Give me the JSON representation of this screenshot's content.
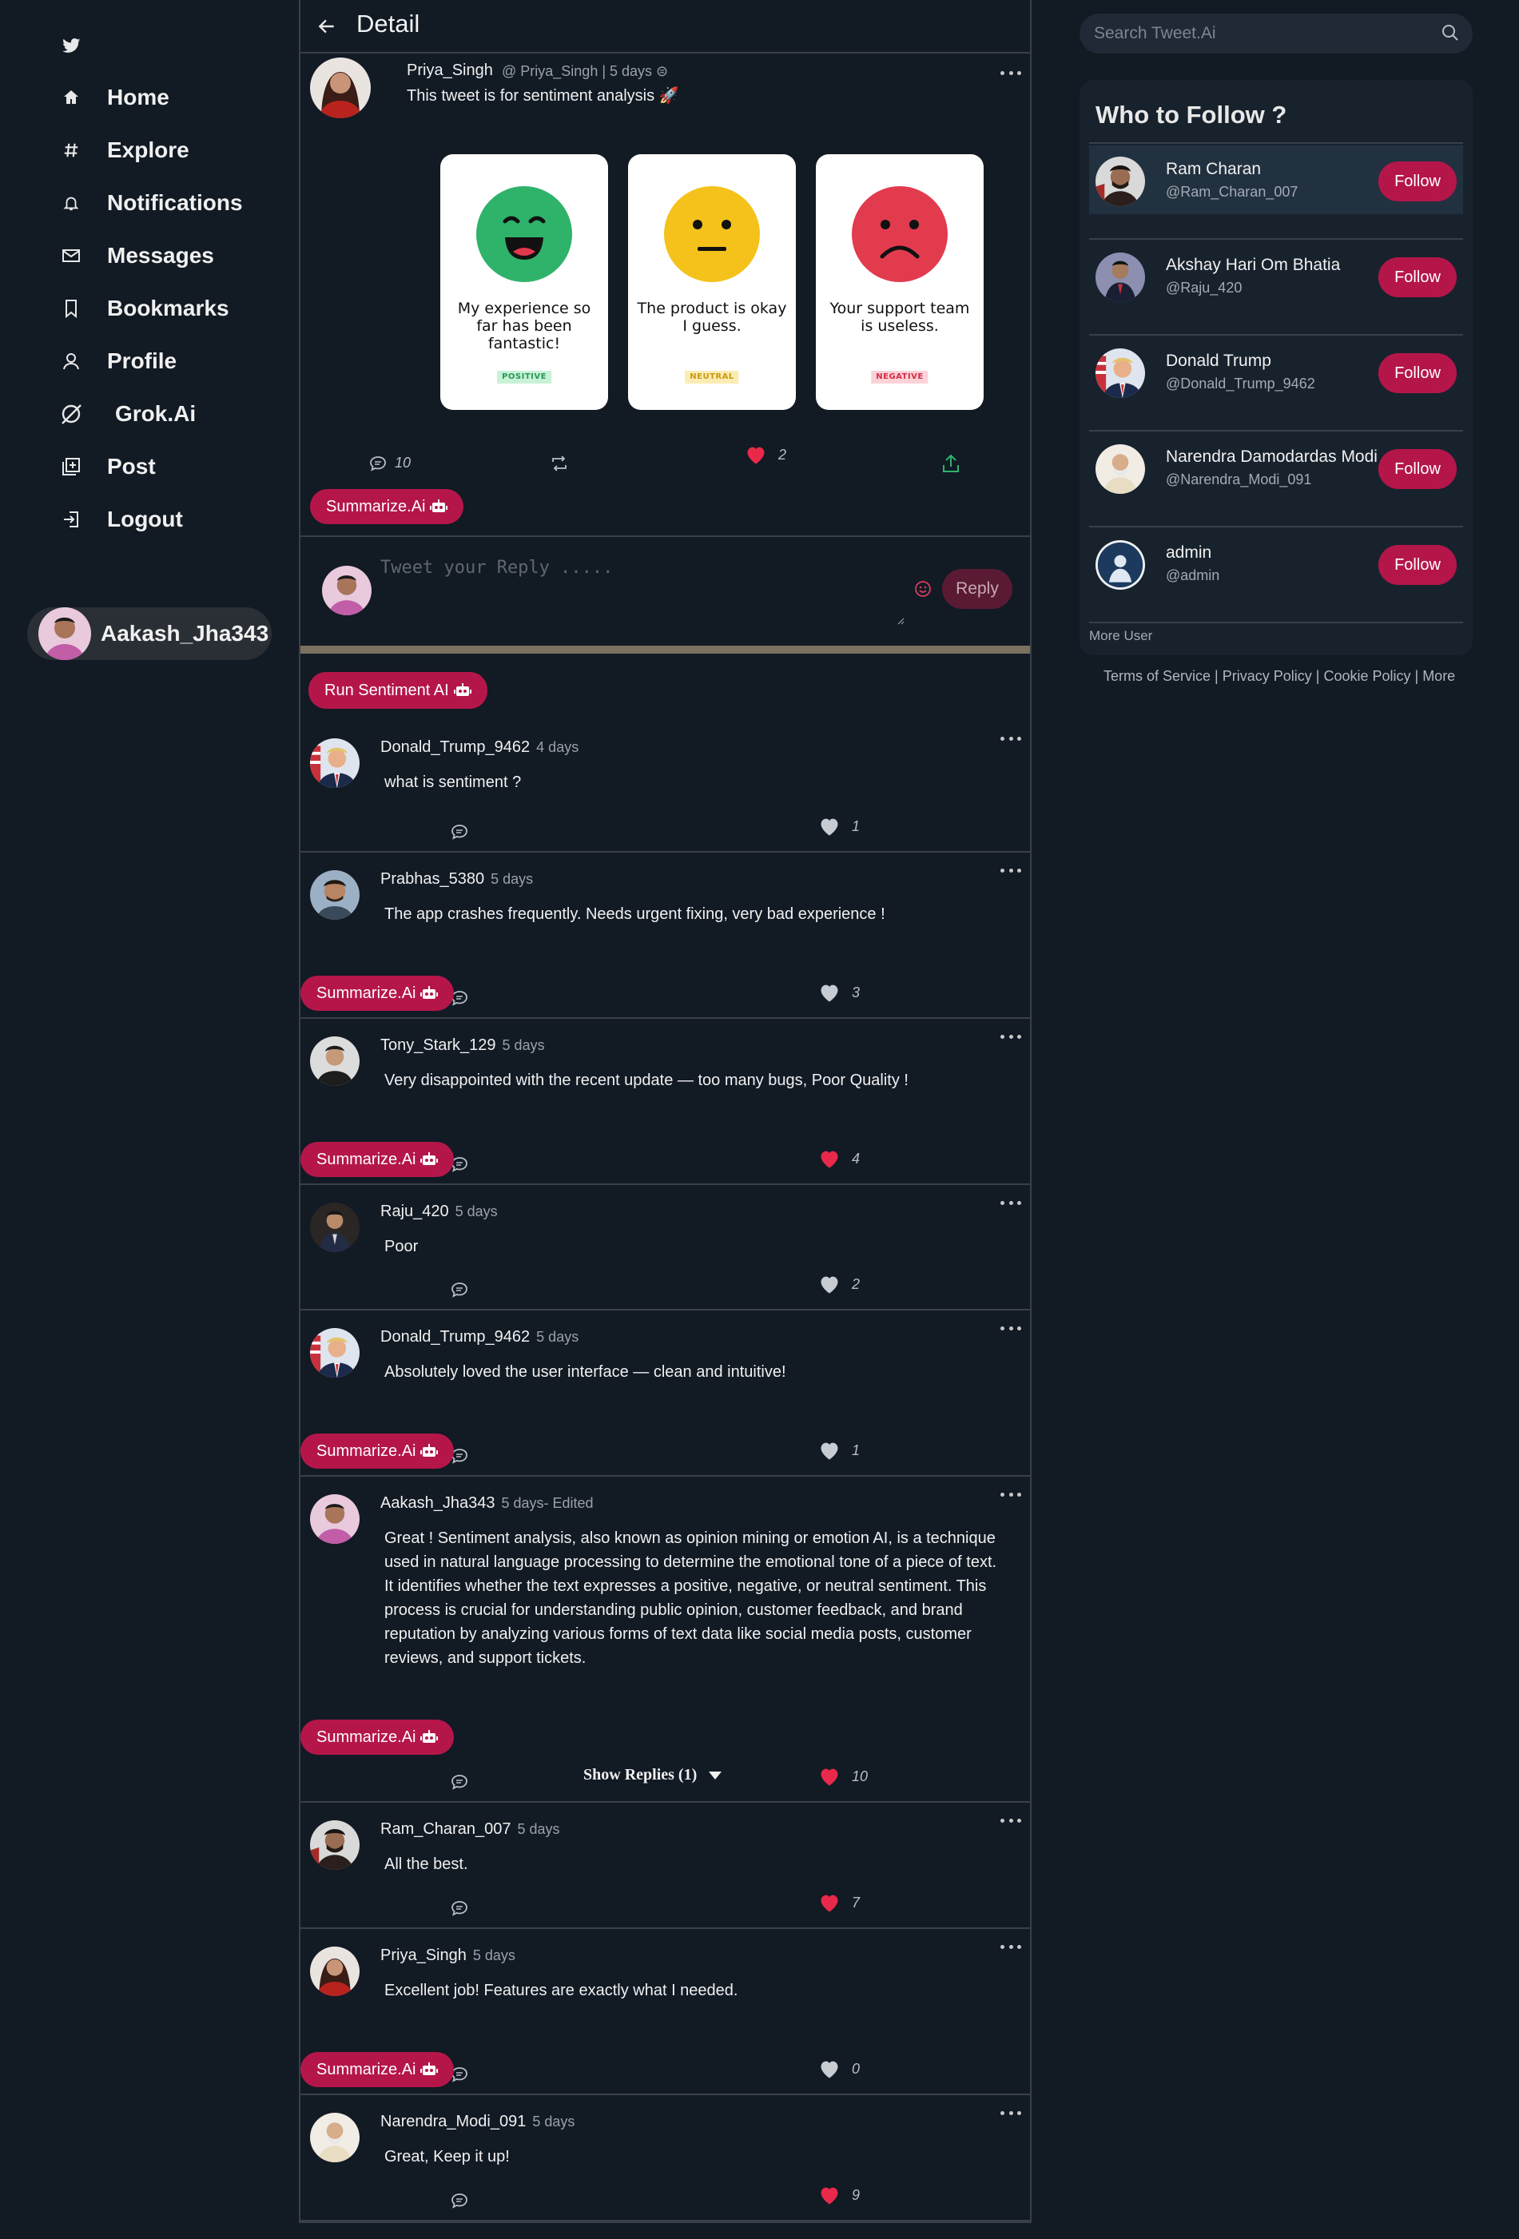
{
  "nav": {
    "items": [
      {
        "label": "Home",
        "icon": "home-icon"
      },
      {
        "label": "Explore",
        "icon": "hash-icon"
      },
      {
        "label": "Notifications",
        "icon": "bell-icon"
      },
      {
        "label": "Messages",
        "icon": "mail-icon"
      },
      {
        "label": "Bookmarks",
        "icon": "bookmark-icon"
      },
      {
        "label": "Profile",
        "icon": "user-icon"
      },
      {
        "label": "Grok.Ai",
        "icon": "grok-icon"
      },
      {
        "label": "Post",
        "icon": "post-icon"
      },
      {
        "label": "Logout",
        "icon": "logout-icon"
      }
    ],
    "profile_name": "Aakash_Jha343"
  },
  "header": {
    "title": "Detail"
  },
  "main_post": {
    "name": "Priya_Singh",
    "meta": "@ Priya_Singh | 5 days ⊜",
    "text": "This tweet is for sentiment analysis 🚀",
    "cards": [
      {
        "text": "My experience so far has been fantastic!",
        "tag": "POSITIVE",
        "face": "happy",
        "color": "#2fb36a"
      },
      {
        "text": "The product is okay I guess.",
        "tag": "NEUTRAL",
        "face": "neutral",
        "color": "#f5c21b"
      },
      {
        "text": "Your support team is useless.",
        "tag": "NEGATIVE",
        "face": "sad",
        "color": "#e23b4e"
      }
    ],
    "comments_count": "10",
    "likes_count": "2",
    "summarize_label": "Summarize.Ai"
  },
  "reply": {
    "placeholder": "Tweet your Reply .....",
    "button": "Reply"
  },
  "run_sentiment_label": "Run Sentiment AI",
  "comments": [
    {
      "name": "Donald_Trump_9462",
      "time": "4 days",
      "text": "what is sentiment ?",
      "likes": "1",
      "liked": false,
      "summarize": false
    },
    {
      "name": "Prabhas_5380",
      "time": "5 days",
      "text": "The app crashes frequently. Needs urgent fixing, very bad experience !",
      "likes": "3",
      "liked": false,
      "summarize": true
    },
    {
      "name": "Tony_Stark_129",
      "time": "5 days",
      "text": "Very disappointed with the recent update — too many bugs, Poor Quality !",
      "likes": "4",
      "liked": true,
      "summarize": true
    },
    {
      "name": "Raju_420",
      "time": "5 days",
      "text": "Poor",
      "likes": "2",
      "liked": false,
      "summarize": false
    },
    {
      "name": "Donald_Trump_9462",
      "time": "5 days",
      "text": "Absolutely loved the user interface — clean and intuitive!",
      "likes": "1",
      "liked": false,
      "summarize": true
    },
    {
      "name": "Aakash_Jha343",
      "time": "5 days- Edited",
      "text": "Great ! Sentiment analysis, also known as opinion mining or emotion AI, is a technique used in natural language processing to determine the emotional tone of a piece of text. It identifies whether the text expresses a positive, negative, or neutral sentiment. This process is crucial for understanding public opinion, customer feedback, and brand reputation by analyzing various forms of text data like social media posts, customer reviews, and support tickets.",
      "likes": "10",
      "liked": true,
      "summarize": true,
      "show_replies": "Show Replies (1)"
    },
    {
      "name": "Ram_Charan_007",
      "time": "5 days",
      "text": "All the best.",
      "likes": "7",
      "liked": true,
      "summarize": false
    },
    {
      "name": "Priya_Singh",
      "time": "5 days",
      "text": "Excellent job! Features are exactly what I needed.",
      "likes": "0",
      "liked": false,
      "summarize": true
    },
    {
      "name": "Narendra_Modi_091",
      "time": "5 days",
      "text": "Great, Keep it up!",
      "likes": "9",
      "liked": true,
      "summarize": false
    }
  ],
  "search": {
    "placeholder": "Search Tweet.Ai"
  },
  "who_to_follow": {
    "title": "Who to Follow ?",
    "users": [
      {
        "name": "Ram Charan",
        "handle": "@Ram_Charan_007"
      },
      {
        "name": "Akshay Hari Om Bhatia",
        "handle": "@Raju_420"
      },
      {
        "name": "Donald Trump",
        "handle": "@Donald_Trump_9462"
      },
      {
        "name": "Narendra Damodardas Modi",
        "handle": "@Narendra_Modi_091"
      },
      {
        "name": "admin",
        "handle": "@admin"
      }
    ],
    "follow_label": "Follow",
    "more_user": "More User"
  },
  "footer": {
    "links": [
      "Terms of Service",
      "Privacy Policy",
      "Cookie Policy",
      "More"
    ]
  },
  "colors": {
    "accent": "#b5164a",
    "like": "#e8294a",
    "background": "#121a24"
  }
}
